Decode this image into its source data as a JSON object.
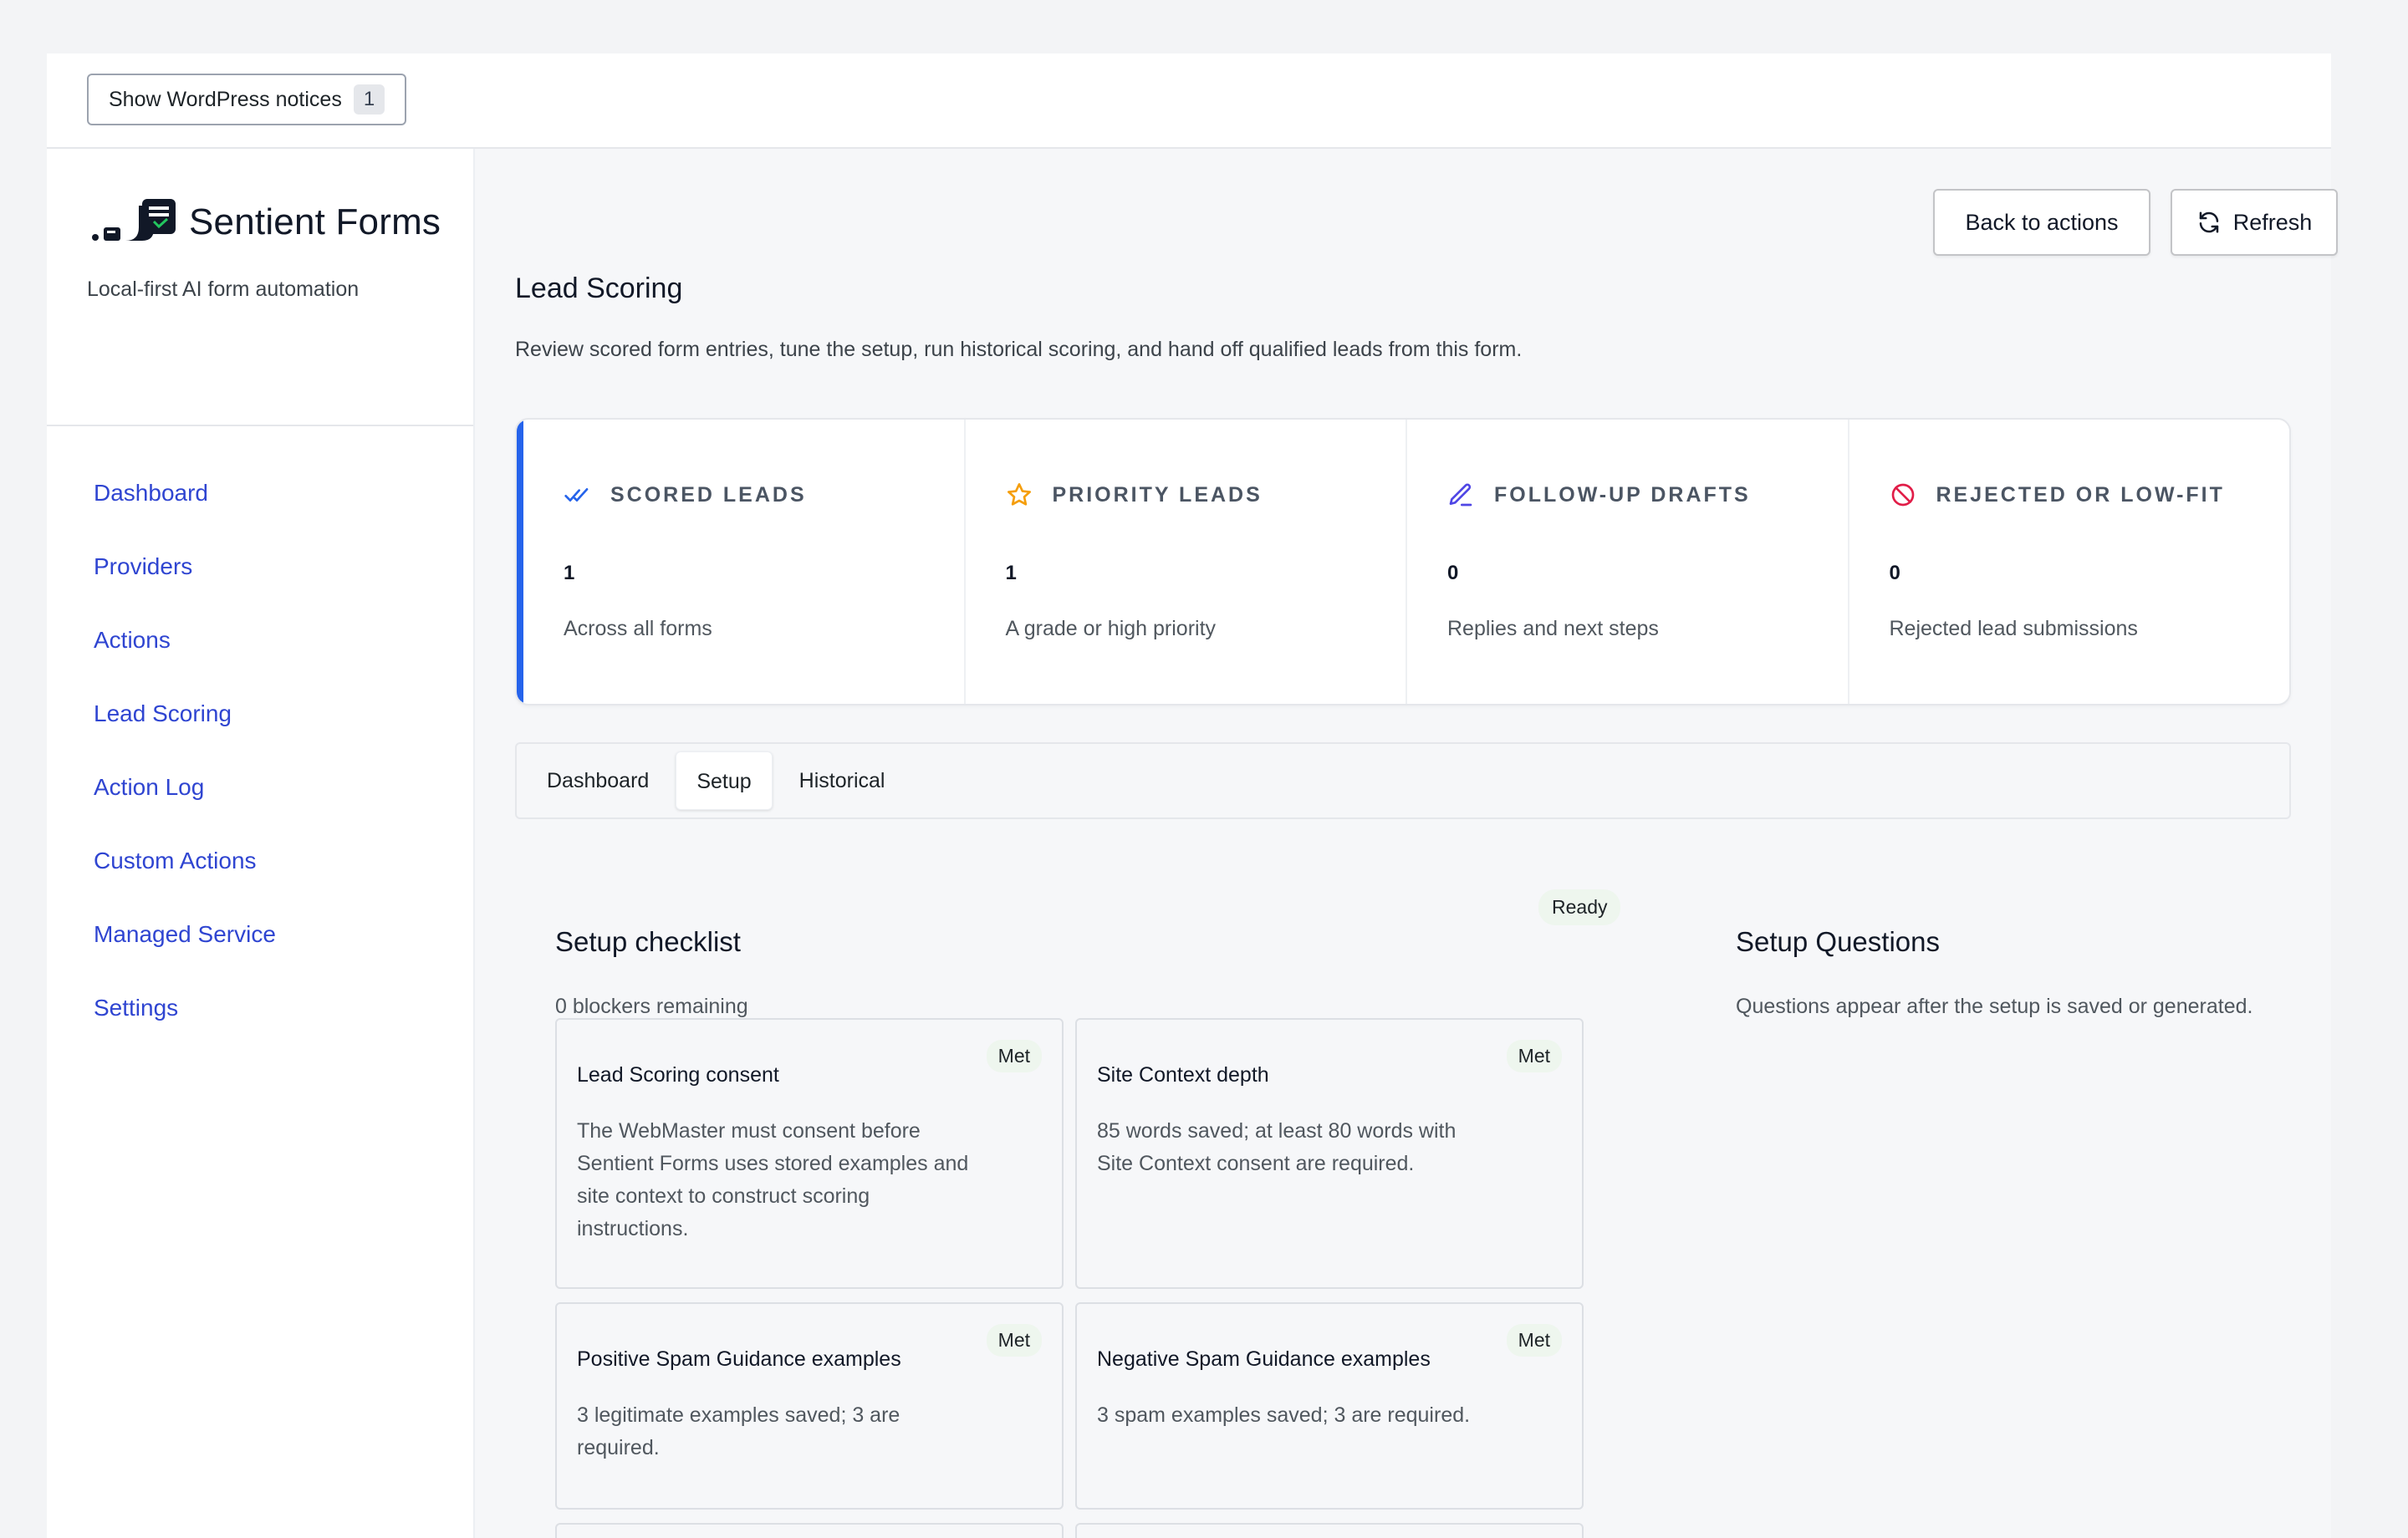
{
  "notices": {
    "label": "Show WordPress notices",
    "count": "1"
  },
  "brand": {
    "name": "Sentient Forms",
    "tagline": "Local-first AI form automation"
  },
  "nav": [
    "Dashboard",
    "Providers",
    "Actions",
    "Lead Scoring",
    "Action Log",
    "Custom Actions",
    "Managed Service",
    "Settings"
  ],
  "header": {
    "title": "Lead Scoring",
    "description": "Review scored form entries, tune the setup, run historical scoring, and hand off qualified leads from this form.",
    "back_label": "Back to actions",
    "refresh_label": "Refresh"
  },
  "stats": [
    {
      "icon": "double-check-icon",
      "label": "SCORED LEADS",
      "value": "1",
      "sub": "Across all forms"
    },
    {
      "icon": "star-icon",
      "label": "PRIORITY LEADS",
      "value": "1",
      "sub": "A grade or high priority"
    },
    {
      "icon": "pencil-icon",
      "label": "FOLLOW-UP DRAFTS",
      "value": "0",
      "sub": "Replies and next steps"
    },
    {
      "icon": "ban-icon",
      "label": "REJECTED OR LOW-FIT",
      "value": "0",
      "sub": "Rejected lead submissions"
    }
  ],
  "tabs": [
    "Dashboard",
    "Setup",
    "Historical"
  ],
  "active_tab": "Setup",
  "checklist": {
    "title": "Setup checklist",
    "status": "Ready",
    "blockers": "0 blockers remaining",
    "items": [
      {
        "title": "Lead Scoring consent",
        "badge": "Met",
        "desc": "The WebMaster must consent before Sentient Forms uses stored examples and site context to construct scoring instructions."
      },
      {
        "title": "Site Context depth",
        "badge": "Met",
        "desc": "85 words saved; at least 80 words with Site Context consent are required."
      },
      {
        "title": "Positive Spam Guidance examples",
        "badge": "Met",
        "desc": "3 legitimate examples saved; 3 are required."
      },
      {
        "title": "Negative Spam Guidance examples",
        "badge": "Met",
        "desc": "3 spam examples saved; 3 are required."
      }
    ]
  },
  "questions": {
    "title": "Setup Questions",
    "desc": "Questions appear after the setup is saved or generated."
  },
  "colors": {
    "accent": "#2563eb",
    "nav_link": "#2f45d1",
    "star": "#f59e0b",
    "ban": "#e11d48",
    "pencil": "#4f46e5"
  }
}
